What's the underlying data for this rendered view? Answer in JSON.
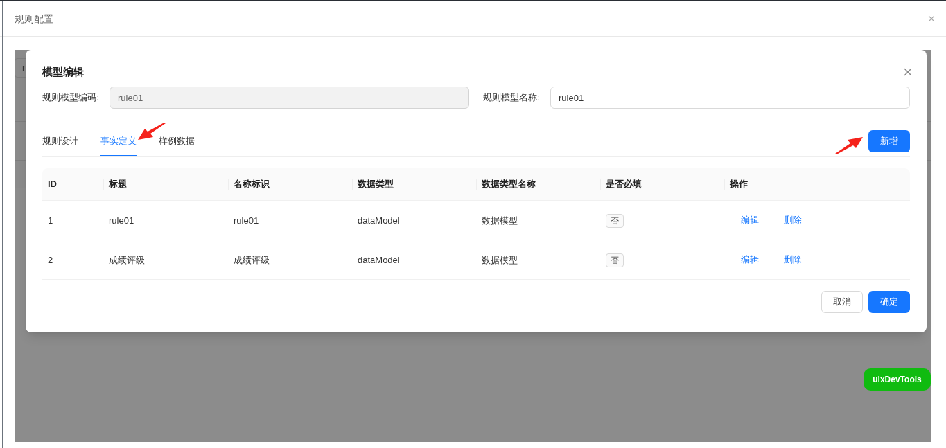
{
  "window": {
    "title": "规则配置"
  },
  "background": {
    "field_value": "r"
  },
  "modal": {
    "title": "模型编辑",
    "fields": [
      {
        "label": "规则模型编码:",
        "value": "rule01",
        "disabled": true
      },
      {
        "label": "规则模型名称:",
        "value": "rule01",
        "disabled": false
      }
    ],
    "tabs": [
      {
        "label": "规则设计",
        "selected": false
      },
      {
        "label": "事实定义",
        "selected": true
      },
      {
        "label": "样例数据",
        "selected": false
      }
    ],
    "add_button": "新增",
    "table": {
      "columns": [
        "ID",
        "标题",
        "名称标识",
        "数据类型",
        "数据类型名称",
        "是否必填",
        "操作"
      ],
      "rows": [
        {
          "cells": [
            "1",
            "rule01",
            "rule01",
            "dataModel",
            "数据模型"
          ],
          "required": "否",
          "actions": [
            "编辑",
            "删除"
          ]
        },
        {
          "cells": [
            "2",
            "成绩评级",
            "成绩评级",
            "dataModel",
            "数据模型"
          ],
          "required": "否",
          "actions": [
            "编辑",
            "删除"
          ]
        }
      ]
    },
    "buttons": [
      {
        "label": "取消",
        "kind": "default"
      },
      {
        "label": "确定",
        "kind": "primary"
      }
    ]
  },
  "devtools_button": "uixDevTools"
}
